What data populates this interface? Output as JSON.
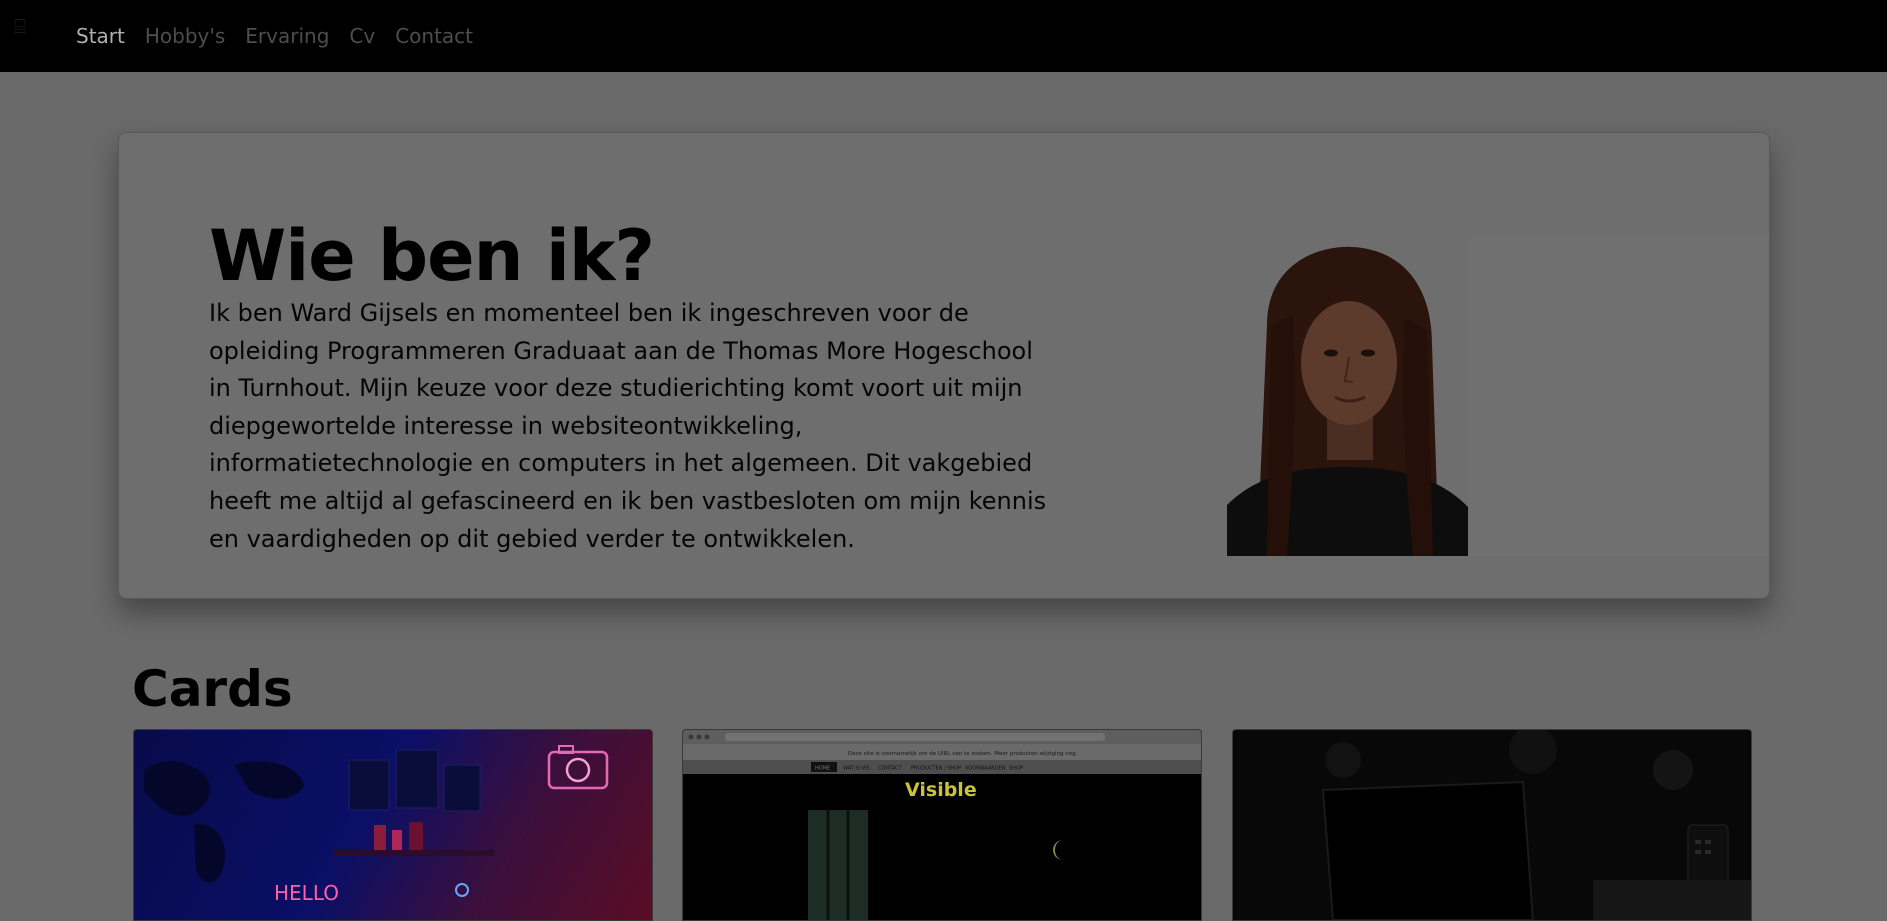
{
  "nav": {
    "items": [
      {
        "label": "Start",
        "active": true
      },
      {
        "label": "Hobby's",
        "active": false
      },
      {
        "label": "Ervaring",
        "active": false
      },
      {
        "label": "Cv",
        "active": false
      },
      {
        "label": "Contact",
        "active": false
      }
    ]
  },
  "hero": {
    "title": "Wie ben ik?",
    "text": "Ik ben Ward Gijsels en momenteel ben ik ingeschreven voor de opleiding Programmeren Graduaat aan de Thomas More Hogeschool in Turnhout. Mijn keuze voor deze studierichting komt voort uit mijn diepgewortelde interesse in websiteontwikkeling, informatietechnologie en computers in het algemeen. Dit vakgebied heeft me altijd al gefascineerd en ik ben vastbesloten om mijn kennis en vaardigheden op dit gebied verder te ontwikkelen."
  },
  "cards_section": {
    "title": "Cards",
    "card2": {
      "banner": "Deze site is voornamelijk om de UIRL van te zoeken. Meer producten wijziging nog.",
      "tabs": [
        "HOME",
        "WAT IS VIS",
        "CONTACT",
        "PRODUCTEN / SHOP",
        "VOORWAARDEN",
        "SHOP"
      ],
      "logo": "Visible"
    },
    "card1": {
      "neon_sign": "HELLO"
    }
  },
  "colors": {
    "navbar": "#000000",
    "overlay_bg": "#6a6a6a",
    "card2_logo": "#c9c23a"
  }
}
